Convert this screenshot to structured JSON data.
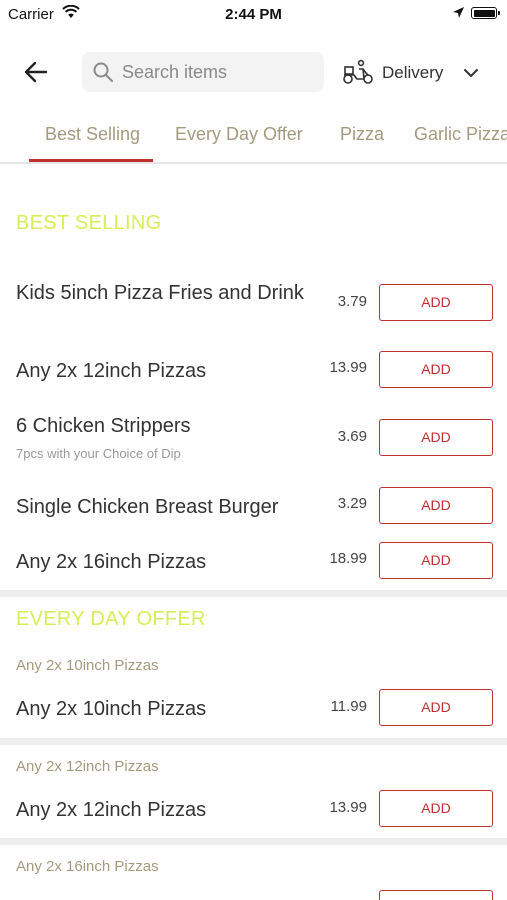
{
  "status_bar": {
    "carrier": "Carrier",
    "time": "2:44 PM"
  },
  "header": {
    "search_placeholder": "Search items",
    "delivery_label": "Delivery"
  },
  "tabs": [
    {
      "label": "Best Selling",
      "active": true
    },
    {
      "label": "Every Day Offer",
      "active": false
    },
    {
      "label": "Pizza",
      "active": false
    },
    {
      "label": "Garlic Pizza",
      "active": false
    }
  ],
  "colors": {
    "accent": "#c0302f",
    "section_title": "#d7ee5a",
    "tab_text": "#a49a7e"
  },
  "icons": [
    "back-arrow-icon",
    "search-icon",
    "scooter-icon",
    "chevron-down-icon",
    "wifi-icon",
    "location-arrow-icon",
    "battery-icon"
  ],
  "sections": {
    "best_selling": {
      "title": "BEST SELLING",
      "items": [
        {
          "name": "Kids 5inch Pizza Fries and Drink",
          "price": "3.79",
          "add_label": "ADD"
        },
        {
          "name": "Any 2x 12inch Pizzas",
          "price": "13.99",
          "add_label": "ADD"
        },
        {
          "name": "6 Chicken Strippers",
          "description": "7pcs with your Choice of Dip",
          "price": "3.69",
          "add_label": "ADD"
        },
        {
          "name": "Single Chicken Breast Burger",
          "price": "3.29",
          "add_label": "ADD"
        },
        {
          "name": "Any 2x 16inch Pizzas",
          "price": "18.99",
          "add_label": "ADD"
        }
      ]
    },
    "every_day_offer": {
      "title": "EVERY DAY OFFER",
      "groups": [
        {
          "heading": "Any 2x 10inch Pizzas",
          "item": {
            "name": "Any 2x 10inch Pizzas",
            "price": "11.99",
            "add_label": "ADD"
          }
        },
        {
          "heading": "Any 2x 12inch Pizzas",
          "item": {
            "name": "Any 2x 12inch Pizzas",
            "price": "13.99",
            "add_label": "ADD"
          }
        },
        {
          "heading": "Any 2x 16inch Pizzas"
        }
      ]
    }
  }
}
